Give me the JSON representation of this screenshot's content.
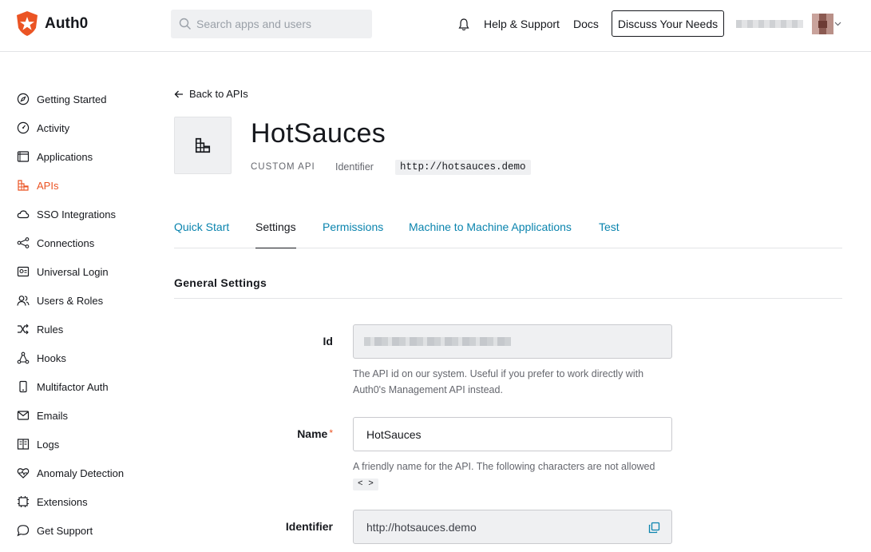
{
  "header": {
    "brand": "Auth0",
    "search_placeholder": "Search apps and users",
    "help_label": "Help & Support",
    "docs_label": "Docs",
    "discuss_label": "Discuss Your Needs"
  },
  "sidebar": {
    "items": [
      {
        "label": "Getting Started",
        "icon": "compass-icon"
      },
      {
        "label": "Activity",
        "icon": "gauge-icon"
      },
      {
        "label": "Applications",
        "icon": "window-icon"
      },
      {
        "label": "APIs",
        "icon": "api-icon",
        "active": true
      },
      {
        "label": "SSO Integrations",
        "icon": "cloud-icon"
      },
      {
        "label": "Connections",
        "icon": "share-icon"
      },
      {
        "label": "Universal Login",
        "icon": "login-icon"
      },
      {
        "label": "Users & Roles",
        "icon": "users-icon"
      },
      {
        "label": "Rules",
        "icon": "shuffle-icon"
      },
      {
        "label": "Hooks",
        "icon": "hooks-icon"
      },
      {
        "label": "Multifactor Auth",
        "icon": "phone-icon"
      },
      {
        "label": "Emails",
        "icon": "mail-icon"
      },
      {
        "label": "Logs",
        "icon": "book-icon"
      },
      {
        "label": "Anomaly Detection",
        "icon": "heart-pulse-icon"
      },
      {
        "label": "Extensions",
        "icon": "chip-icon"
      },
      {
        "label": "Get Support",
        "icon": "chat-icon"
      }
    ]
  },
  "main": {
    "back_label": "Back to APIs",
    "api_name": "HotSauces",
    "api_type": "CUSTOM API",
    "identifier_label": "Identifier",
    "identifier_value": "http://hotsauces.demo",
    "tabs": [
      {
        "label": "Quick Start"
      },
      {
        "label": "Settings",
        "active": true
      },
      {
        "label": "Permissions"
      },
      {
        "label": "Machine to Machine Applications"
      },
      {
        "label": "Test"
      }
    ],
    "section_title": "General Settings",
    "fields": {
      "id": {
        "label": "Id",
        "help": "The API id on our system. Useful if you prefer to work directly with Auth0's Management API instead."
      },
      "name": {
        "label": "Name",
        "required_mark": "*",
        "value": "HotSauces",
        "help": "A friendly name for the API. The following characters are not allowed",
        "disallowed": "< >"
      },
      "identifier": {
        "label": "Identifier",
        "value": "http://hotsauces.demo"
      }
    }
  },
  "colors": {
    "accent": "#eb5424",
    "link": "#0a84ae",
    "text": "#16181d",
    "muted": "#65676e",
    "readonly_bg": "#eff0f2"
  }
}
